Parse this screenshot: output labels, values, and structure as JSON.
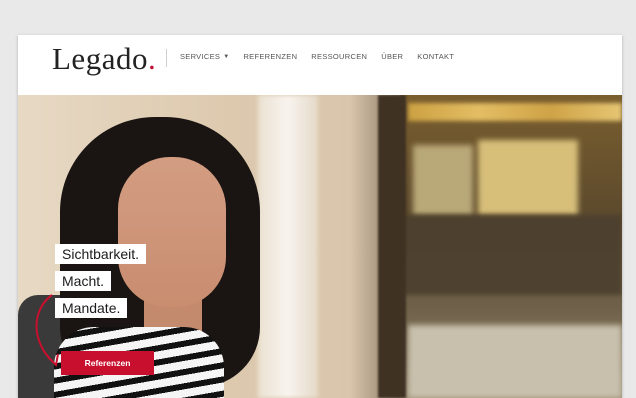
{
  "header": {
    "logo": "Legado",
    "logo_dot": ".",
    "nav": [
      {
        "label": "SERVICES",
        "has_dropdown": true
      },
      {
        "label": "REFERENZEN"
      },
      {
        "label": "RESSOURCEN"
      },
      {
        "label": "ÜBER"
      },
      {
        "label": "KONTAKT"
      }
    ]
  },
  "hero": {
    "taglines": [
      "Sichtbarkeit.",
      "Macht.",
      "Mandate."
    ],
    "cta_label": "Referenzen"
  },
  "colors": {
    "accent": "#c8102e",
    "background": "#e9e9e9"
  },
  "icons": {
    "dropdown": "chevron-down-icon",
    "arrow": "curved-arrow-icon"
  }
}
